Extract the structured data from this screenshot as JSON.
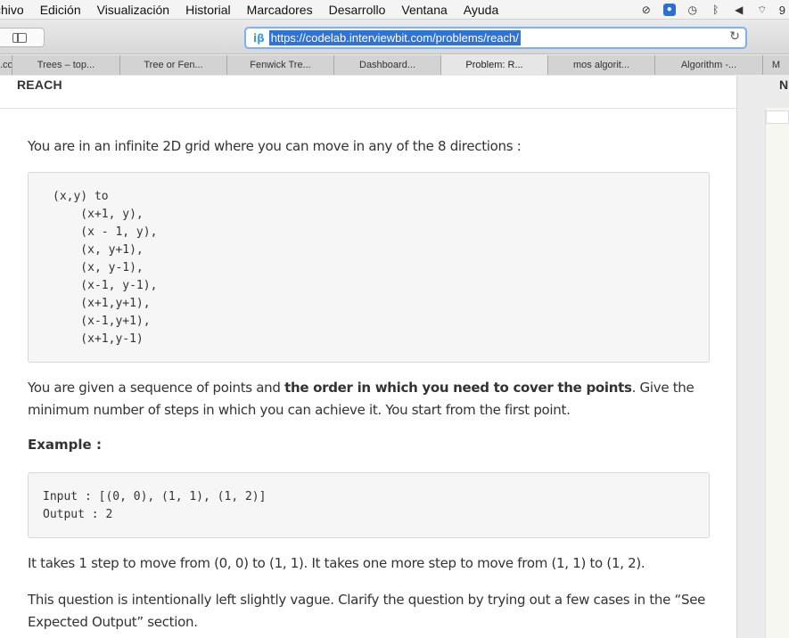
{
  "menubar": {
    "items": [
      "chivo",
      "Edición",
      "Visualización",
      "Historial",
      "Marcadores",
      "Desarrollo",
      "Ventana",
      "Ayuda"
    ]
  },
  "status_icons": [
    "circle-slash-icon",
    "lastpass-icon",
    "time-machine-icon",
    "bluetooth-icon",
    "volume-icon",
    "wifi-icon"
  ],
  "status_clip_text": "9",
  "browser": {
    "site_icon_text": "iβ",
    "url": "https://codelab.interviewbit.com/problems/reach/",
    "tabs": [
      {
        "label": ".co"
      },
      {
        "label": "Trees – top..."
      },
      {
        "label": "Tree or Fen..."
      },
      {
        "label": "Fenwick Tre..."
      },
      {
        "label": "Dashboard..."
      },
      {
        "label": "Problem: R..."
      },
      {
        "label": "mos algorit..."
      },
      {
        "label": "Algorithm -..."
      },
      {
        "label": "M"
      }
    ],
    "active_tab": 5,
    "accent_color": "#7ab2f0",
    "selection_color": "#2f73d6"
  },
  "problem": {
    "title": "REACH",
    "intro": "You are in an infinite 2D grid where you can move in any of the 8 directions :",
    "moves_code": "(x,y) to\n    (x+1, y),\n    (x - 1, y),\n    (x, y+1),\n    (x, y-1),\n    (x-1, y-1),\n    (x+1,y+1),\n    (x-1,y+1),\n    (x+1,y-1)",
    "task_before": "You are given a sequence of points and ",
    "task_bold": "the order in which you need to cover the points",
    "task_after": ". Give the minimum number of steps in which you can achieve it. You start from the first point.",
    "example_label": "Example :",
    "example_code": "Input : [(0, 0), (1, 1), (1, 2)]\nOutput : 2",
    "explanation": "It takes 1 step to move from (0, 0) to (1, 1). It takes one more step to move from (1, 1) to (1, 2).",
    "note": "This question is intentionally left slightly vague. Clarify the question by trying out a few cases in the “See Expected Output” section."
  },
  "right_panel": {
    "title": "N"
  }
}
